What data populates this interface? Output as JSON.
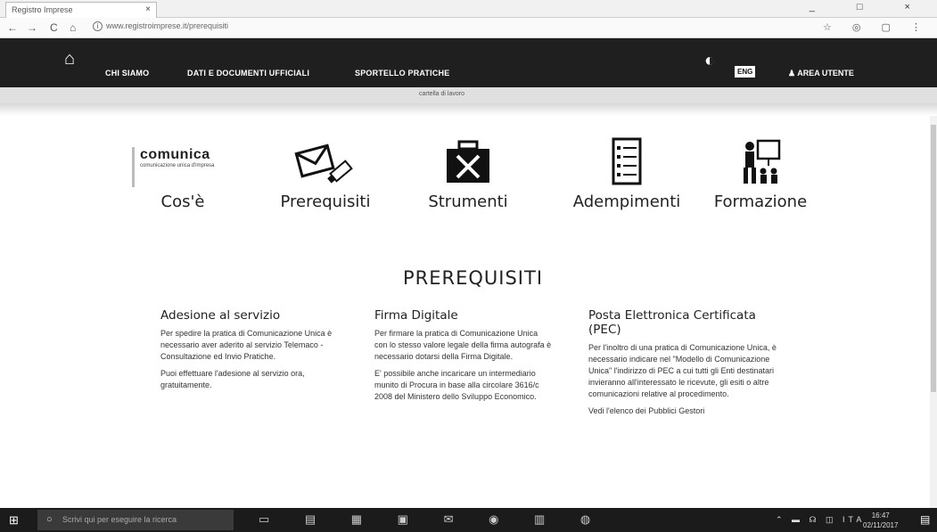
{
  "browser": {
    "tab_title": "Registro Imprese",
    "tab_close": "×",
    "url": "www.registroimprese.it/prerequisiti",
    "window_controls": "_ □ ×",
    "nav": {
      "back": "←",
      "forward": "→",
      "reload": "C",
      "home": "⌂"
    },
    "ext_icons": "☆ ◎ ▢ ⋮"
  },
  "site_nav": {
    "links": [
      "CHI SIAMO",
      "DATI E DOCUMENTI UFFICIALI",
      "SPORTELLO PRATICHE"
    ],
    "lang": "ENG",
    "area_utente": "AREA UTENTE",
    "subbar_text": "cartella di lavoro"
  },
  "categories": [
    {
      "label": "Cos'è",
      "icon": "comunica-logo"
    },
    {
      "label": "Prerequisiti",
      "icon": "envelope-usb-icon"
    },
    {
      "label": "Strumenti",
      "icon": "toolbox-icon"
    },
    {
      "label": "Adempimenti",
      "icon": "checklist-icon"
    },
    {
      "label": "Formazione",
      "icon": "presentation-icon"
    }
  ],
  "comunica_logo": {
    "big": "comunica",
    "small": "comunicazione unica d'impresa"
  },
  "section_title": "PREREQUISITI",
  "columns": [
    {
      "title": "Adesione al servizio",
      "paragraphs": [
        "Per spedire la pratica di Comunicazione Unica è necessario aver aderito al servizio Telemaco - Consultazione ed Invio Pratiche.",
        "Puoi effettuare l'adesione al servizio ora, gratuitamente."
      ]
    },
    {
      "title": "Firma Digitale",
      "paragraphs": [
        "Per firmare la pratica di Comunicazione Unica con lo stesso valore legale della firma autografa è necessario dotarsi della Firma Digitale.",
        "E' possibile anche incaricare un intermediario munito di Procura in base alla circolare 3616/c 2008 del Ministero dello Sviluppo Economico."
      ]
    },
    {
      "title": "Posta Elettronica Certificata (PEC)",
      "paragraphs": [
        "Per l'inoltro di una pratica di Comunicazione Unica, è necessario indicare nel \"Modello di Comunicazione Unica\" l'indirizzo di PEC a cui tutti gli Enti destinatari invieranno all'interessato le ricevute, gli esiti o altre comunicazioni relative al procedimento.",
        "Vedi l'elenco dei Pubblici Gestori"
      ]
    }
  ],
  "taskbar": {
    "search_placeholder": "Scrivi qui per eseguire la ricerca",
    "tray": "⌃ ▬ ☊ ◫ ITA",
    "time": "16:47",
    "date": "02/11/2017"
  }
}
